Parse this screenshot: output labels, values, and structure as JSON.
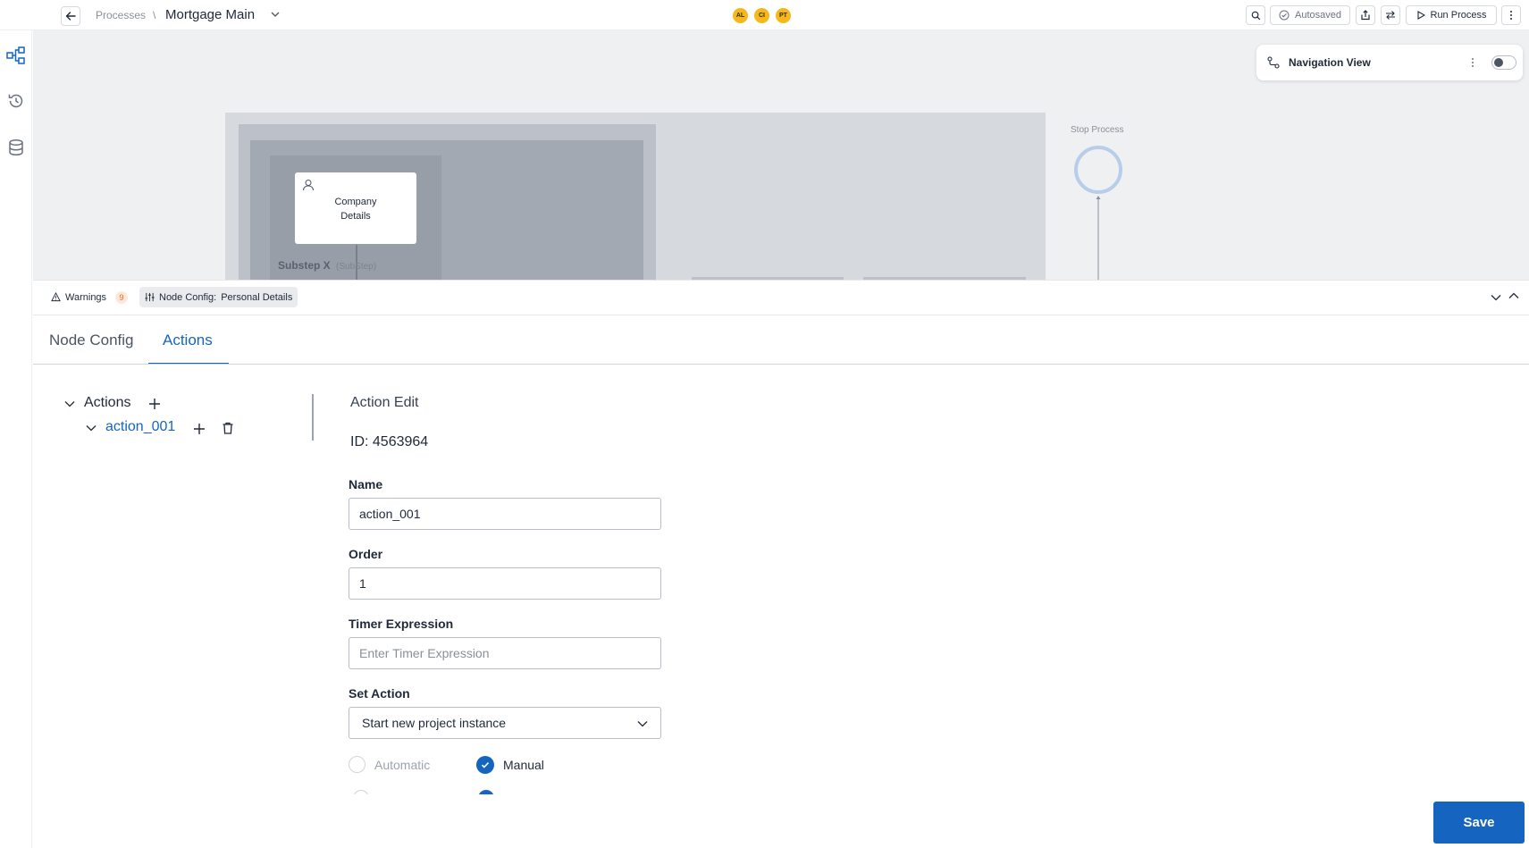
{
  "header": {
    "breadcrumb_root": "Processes",
    "breadcrumb_sep": "\\",
    "title": "Mortgage Main",
    "avatars": [
      "AL",
      "CI",
      "PT"
    ],
    "autosaved_label": "Autosaved",
    "run_label": "Run Process"
  },
  "canvas": {
    "nav_view_label": "Navigation View",
    "node_label_line1": "Company",
    "node_label_line2": "Details",
    "substep_label": "Substep X",
    "substep_tag": "(SubStep)",
    "stop_label": "Stop Process"
  },
  "panel": {
    "warnings_label": "Warnings",
    "warnings_count": "9",
    "node_config_prefix": "Node Config:",
    "node_config_name": "Personal Details",
    "tabs": [
      {
        "label": "Node Config",
        "active": false
      },
      {
        "label": "Actions",
        "active": true
      }
    ],
    "tree": {
      "root_label": "Actions",
      "child_label": "action_001"
    },
    "edit": {
      "heading": "Action Edit",
      "id_text": "ID: 4563964",
      "name_label": "Name",
      "name_value": "action_001",
      "order_label": "Order",
      "order_value": "1",
      "timer_label": "Timer Expression",
      "timer_placeholder": "Enter Timer Expression",
      "set_action_label": "Set Action",
      "set_action_value": "Start new project instance",
      "radio_automatic": "Automatic",
      "radio_manual": "Manual"
    },
    "save_label": "Save"
  },
  "colors": {
    "accent": "#1565c0",
    "avatar": "#f5b81a",
    "canvas_bg": "#eff0f2"
  }
}
